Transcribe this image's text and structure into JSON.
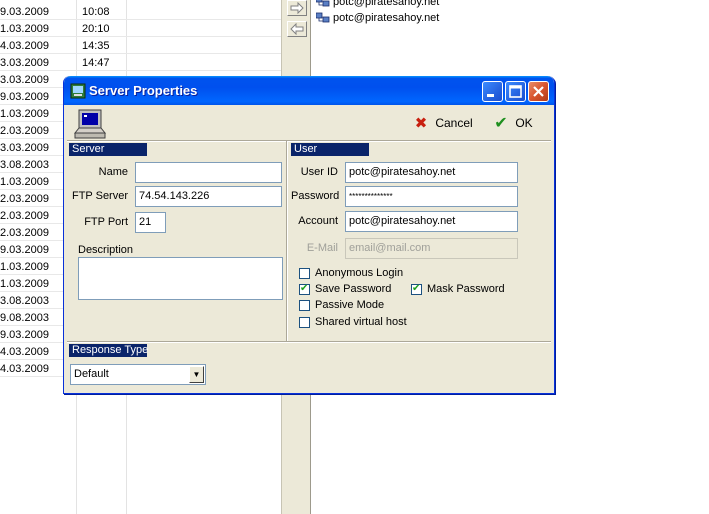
{
  "background": {
    "rows": [
      {
        "date": "9.03.2009",
        "time": "10:08"
      },
      {
        "date": "1.03.2009",
        "time": "20:10"
      },
      {
        "date": "4.03.2009",
        "time": "14:35"
      },
      {
        "date": "3.03.2009",
        "time": "14:47"
      },
      {
        "date": "3.03.2009",
        "time": ""
      },
      {
        "date": "9.03.2009",
        "time": ""
      },
      {
        "date": "1.03.2009",
        "time": ""
      },
      {
        "date": "2.03.2009",
        "time": ""
      },
      {
        "date": "3.03.2009",
        "time": ""
      },
      {
        "date": "3.08.2003",
        "time": ""
      },
      {
        "date": "1.03.2009",
        "time": ""
      },
      {
        "date": "2.03.2009",
        "time": ""
      },
      {
        "date": "2.03.2009",
        "time": ""
      },
      {
        "date": "2.03.2009",
        "time": ""
      },
      {
        "date": "9.03.2009",
        "time": ""
      },
      {
        "date": "1.03.2009",
        "time": ""
      },
      {
        "date": "1.03.2009",
        "time": ""
      },
      {
        "date": "3.08.2003",
        "time": ""
      },
      {
        "date": "9.08.2003",
        "time": ""
      },
      {
        "date": "9.03.2009",
        "time": ""
      },
      {
        "date": "4.03.2009",
        "time": ""
      },
      {
        "date": "4.03.2009",
        "time": ""
      }
    ],
    "servers": [
      "potc@piratesahoy.net",
      "potc@piratesahoy.net"
    ]
  },
  "dialog": {
    "title": "Server Properties",
    "cancel_label": "Cancel",
    "ok_label": "OK",
    "server": {
      "header": "Server",
      "name_label": "Name",
      "name_value": "",
      "ftp_server_label": "FTP Server",
      "ftp_server_value": "74.54.143.226",
      "ftp_port_label": "FTP Port",
      "ftp_port_value": "21",
      "description_label": "Description",
      "description_value": ""
    },
    "user": {
      "header": "User",
      "user_id_label": "User ID",
      "user_id_value": "potc@piratesahoy.net",
      "password_label": "Password",
      "password_value": "**************",
      "account_label": "Account",
      "account_value": "potc@piratesahoy.net",
      "email_label": "E-Mail",
      "email_placeholder": "email@mail.com",
      "anonymous_label": "Anonymous Login",
      "anonymous_checked": false,
      "save_password_label": "Save Password",
      "save_password_checked": true,
      "mask_password_label": "Mask Password",
      "mask_password_checked": true,
      "passive_label": "Passive Mode",
      "passive_checked": false,
      "shared_label": "Shared virtual host",
      "shared_checked": false
    },
    "response": {
      "header": "Response Type",
      "selected": "Default"
    }
  }
}
